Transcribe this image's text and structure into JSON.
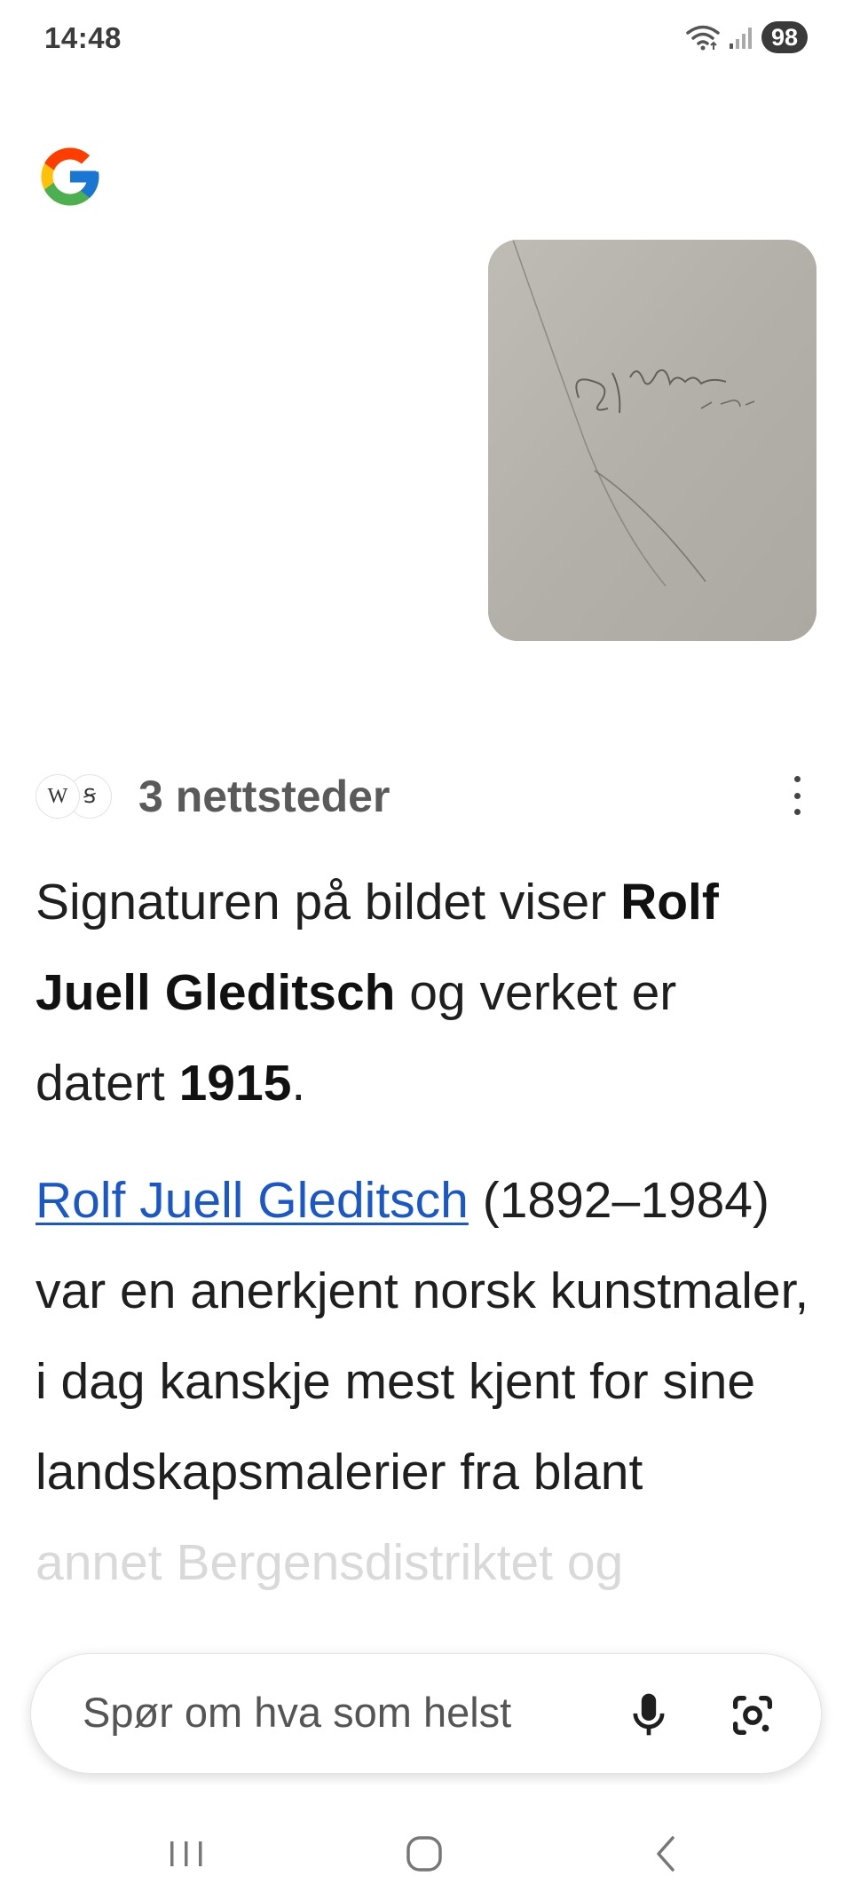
{
  "status_bar": {
    "time": "14:48",
    "battery": "98",
    "icons": [
      "wifi-icon",
      "signal-icon",
      "battery-icon"
    ]
  },
  "logo": {
    "name": "google-logo-icon"
  },
  "query_image": {
    "description_icon": "signature-photo"
  },
  "sources": {
    "label": "3 nettsteder",
    "favicons": [
      "W",
      "Ꞩ"
    ]
  },
  "answer": {
    "p1_prefix": "Signaturen på bildet viser ",
    "p1_name": "Rolf Juell Gleditsch",
    "p1_mid": " og verket er datert ",
    "p1_year": "1915",
    "p1_end": ".",
    "p2_link": "Rolf Juell Gleditsch",
    "p2_rest": " (1892–1984) var en anerkjent norsk kunstmaler, i dag kanskje mest kjent for sine landskapsmalerier fra blant",
    "p2_faded": "annet Bergensdistriktet og"
  },
  "search": {
    "placeholder": "Spør om hva som helst"
  },
  "colors": {
    "link": "#1a57c8",
    "text": "#1f1f1f",
    "muted": "#5a5a5a"
  }
}
